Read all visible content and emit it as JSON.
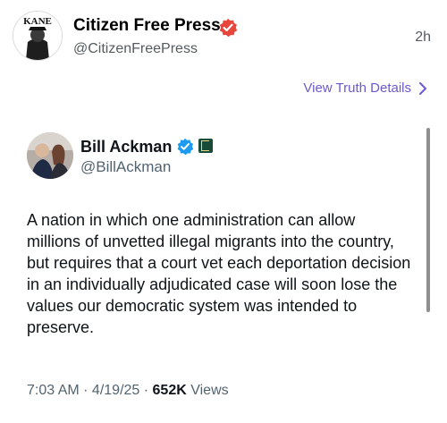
{
  "post": {
    "author_name": "Citizen Free Press",
    "author_handle": "@CitizenFreePress",
    "time": "2h",
    "avatar_text": "KANE"
  },
  "details_link": {
    "label": "View Truth Details"
  },
  "quoted_post": {
    "author_name": "Bill Ackman",
    "author_handle": "@BillAckman",
    "text": "A nation in which one administration can allow millions of unvetted illegal migrants into the country, but requires that a court vet each deportation decision in an individually adjudicated case will soon lose the values our democratic system was intended to preserve.",
    "time": "7:03 AM",
    "date": "4/19/25",
    "views_count": "652K",
    "views_label": "Views"
  },
  "colors": {
    "verified_main": "#e8453c",
    "verified_quote": "#1d9bf0",
    "link": "#6a5ad1"
  }
}
